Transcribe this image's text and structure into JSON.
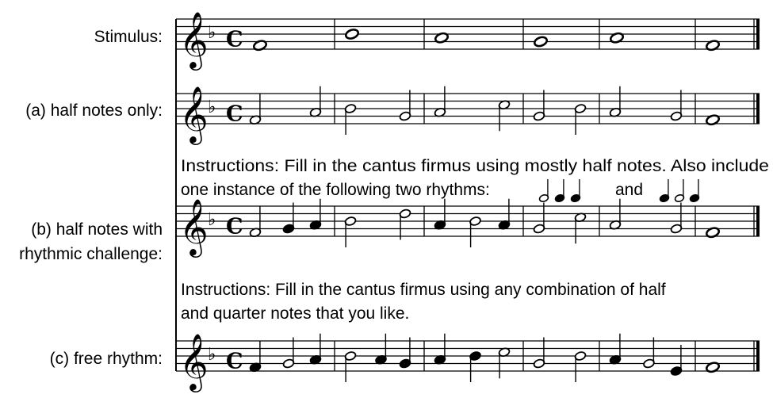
{
  "labels": {
    "stimulus": "Stimulus:",
    "a": "(a) half notes only:",
    "b_line1": "(b) half notes with",
    "b_line2": "rhythmic challenge:",
    "c": "(c) free rhythm:"
  },
  "instructions_b": {
    "line1": "Instructions: Fill in the cantus firmus using mostly half notes. Also include",
    "line2": "one instance of the following two rhythms:",
    "and": "and"
  },
  "instructions_c": {
    "line1": "Instructions: Fill in the cantus firmus using any combination of half",
    "line2": "and quarter notes that you like."
  },
  "key_signature": "F major (one flat)",
  "time_signature": "C",
  "clef": "treble",
  "staves": [
    {
      "id": "stimulus",
      "bars": [
        [
          {
            "p": "F4",
            "d": "w"
          }
        ],
        [
          {
            "p": "Bb4",
            "d": "w"
          }
        ],
        [
          {
            "p": "A4",
            "d": "w"
          }
        ],
        [
          {
            "p": "G4",
            "d": "w"
          }
        ],
        [
          {
            "p": "A4",
            "d": "w"
          }
        ],
        [
          {
            "p": "F4",
            "d": "w"
          }
        ]
      ]
    },
    {
      "id": "a",
      "bars": [
        [
          {
            "p": "F4",
            "d": "h"
          },
          {
            "p": "A4",
            "d": "h"
          }
        ],
        [
          {
            "p": "Bb4",
            "d": "h"
          },
          {
            "p": "G4",
            "d": "h"
          }
        ],
        [
          {
            "p": "A4",
            "d": "h"
          },
          {
            "p": "C5",
            "d": "h"
          }
        ],
        [
          {
            "p": "G4",
            "d": "h"
          },
          {
            "p": "Bb4",
            "d": "h"
          }
        ],
        [
          {
            "p": "A4",
            "d": "h"
          },
          {
            "p": "G4",
            "d": "h"
          }
        ],
        [
          {
            "p": "F4",
            "d": "w"
          }
        ]
      ]
    },
    {
      "id": "b",
      "bars": [
        [
          {
            "p": "F4",
            "d": "h"
          },
          {
            "p": "G4",
            "d": "q"
          },
          {
            "p": "A4",
            "d": "q"
          }
        ],
        [
          {
            "p": "Bb4",
            "d": "h"
          },
          {
            "p": "D5",
            "d": "h"
          }
        ],
        [
          {
            "p": "A4",
            "d": "q"
          },
          {
            "p": "Bb4",
            "d": "h"
          },
          {
            "p": "A4",
            "d": "q"
          }
        ],
        [
          {
            "p": "G4",
            "d": "h"
          },
          {
            "p": "C5",
            "d": "h"
          }
        ],
        [
          {
            "p": "A4",
            "d": "h"
          },
          {
            "p": "G4",
            "d": "h"
          }
        ],
        [
          {
            "p": "F4",
            "d": "w"
          }
        ]
      ]
    },
    {
      "id": "c",
      "bars": [
        [
          {
            "p": "F4",
            "d": "q"
          },
          {
            "p": "G4",
            "d": "h"
          },
          {
            "p": "A4",
            "d": "q"
          }
        ],
        [
          {
            "p": "Bb4",
            "d": "h"
          },
          {
            "p": "A4",
            "d": "q"
          },
          {
            "p": "G4",
            "d": "q"
          }
        ],
        [
          {
            "p": "A4",
            "d": "q"
          },
          {
            "p": "Bb4",
            "d": "q"
          },
          {
            "p": "C5",
            "d": "h"
          }
        ],
        [
          {
            "p": "G4",
            "d": "h"
          },
          {
            "p": "Bb4",
            "d": "h"
          }
        ],
        [
          {
            "p": "A4",
            "d": "q"
          },
          {
            "p": "G4",
            "d": "h"
          },
          {
            "p": "E4",
            "d": "q"
          }
        ],
        [
          {
            "p": "F4",
            "d": "w"
          }
        ]
      ]
    }
  ],
  "rhythm_examples": {
    "first": [
      "h",
      "q",
      "q"
    ],
    "second": [
      "q",
      "h",
      "q"
    ]
  }
}
